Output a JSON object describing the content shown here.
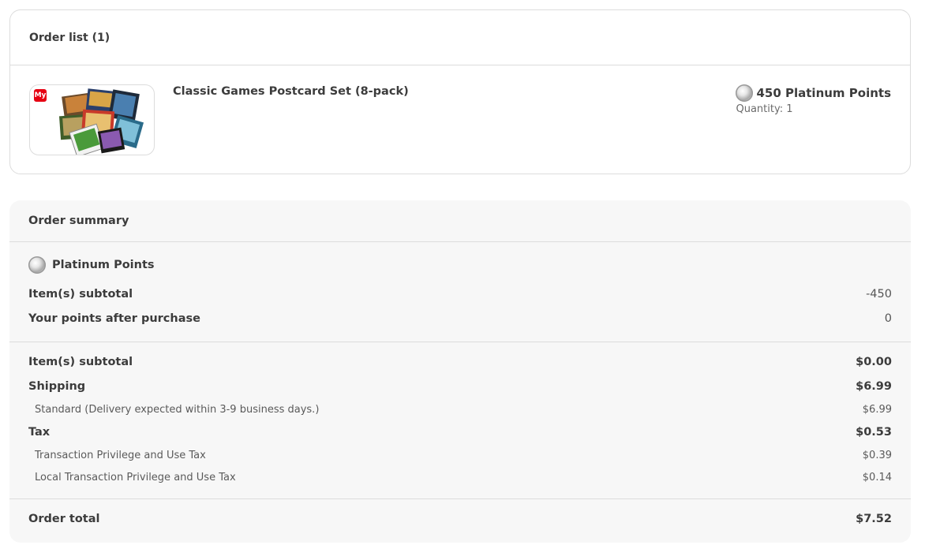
{
  "order_list": {
    "title": "Order list (1)",
    "item": {
      "badge": "My",
      "name": "Classic Games Postcard Set (8-pack)",
      "price": "450 Platinum Points",
      "quantity": "Quantity: 1"
    }
  },
  "summary": {
    "title": "Order summary",
    "points_section": {
      "label": "Platinum Points",
      "items_subtotal_label": "Item(s) subtotal",
      "items_subtotal_value": "-450",
      "points_after_label": "Your points after purchase",
      "points_after_value": "0"
    },
    "items_subtotal_label": "Item(s) subtotal",
    "items_subtotal_value": "$0.00",
    "shipping_label": "Shipping",
    "shipping_value": "$6.99",
    "shipping_detail_label": "Standard (Delivery expected within 3-9 business days.)",
    "shipping_detail_value": "$6.99",
    "tax_label": "Tax",
    "tax_value": "$0.53",
    "tax_detail_1_label": "Transaction Privilege and Use Tax",
    "tax_detail_1_value": "$0.39",
    "tax_detail_2_label": "Local Transaction Privilege and Use Tax",
    "tax_detail_2_value": "$0.14",
    "order_total_label": "Order total",
    "order_total_value": "$7.52"
  },
  "colors": {
    "brand_red": "#e60012",
    "summary_bg": "#f7f7f7",
    "border": "#dcdcdc"
  }
}
